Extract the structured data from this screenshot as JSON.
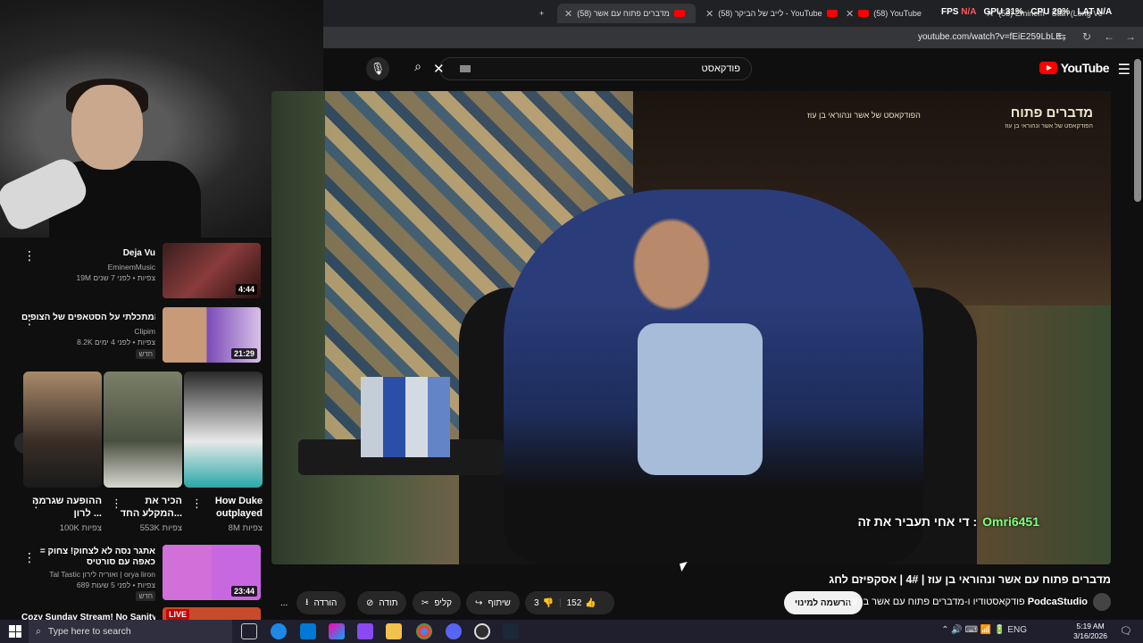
{
  "browser": {
    "tabs": [
      {
        "label": "(58) Eminem - Stan (Long Ve"
      },
      {
        "label": "(58) YouTube"
      },
      {
        "label": "(58) לייב של הביקר - YouTube"
      },
      {
        "label": "(58) מדברים פתוח עם אשר"
      }
    ],
    "new_tab": "+",
    "url": "youtube.com/watch?v=fEiE259LbLE"
  },
  "hud": {
    "fps_label": "FPS",
    "fps": "N/A",
    "gpu": "GPU 31%",
    "cpu": "CPU 29%",
    "lat_label": "LAT",
    "lat": "N/A"
  },
  "header": {
    "search_text": "פודקאסט",
    "logo": "YouTube"
  },
  "video": {
    "banner_title": "מדברים פתוח",
    "banner_sub": "הפודקאסט של אשר ונהוראי בן עוז",
    "banner_top_sub": "הפודקאסט של אשר ונהוראי בן עוז",
    "chat_user": "Omri6451",
    "chat_message": "די אחי תעביר את זה :",
    "title": "מדברים פתוח עם אשר ונהוראי בן עוז | 4# | אסקפיזם לחג"
  },
  "actions": {
    "likes": "152",
    "dislikes": "3",
    "share": "שיתוף",
    "clip": "קליפ",
    "thanks": "תודה",
    "download": "הורדה",
    "more": "...",
    "subscribe": "הרשמה למינוי",
    "channel_name": "PodcaStudio",
    "channel_desc": "- פודקאסטודיו ו-מדברים פתוח עם אשר בן עוז"
  },
  "sidebar": {
    "recs": [
      {
        "title": "Deja Vu",
        "channel": "EminemMusic",
        "meta": "19M צפיות • לפני 7 שנים",
        "duration": "4:44",
        "new": ""
      },
      {
        "title": "המתכלתי על הסטאפים של הצופים...",
        "channel": "Clipim",
        "meta": "8.2K צפיות • לפני 4 ימים",
        "duration": "21:29",
        "new": "חדש"
      },
      {
        "title": "אתגר נסה לא לצחוק! צחוק = כאפה עם סורטיס",
        "channel": "Tal Tastic ואוריה לירון | orya liron",
        "meta": "689 צפיות • לפני 5 שעות",
        "duration": "23:44",
        "new": "חדש"
      },
      {
        "title": "Cozy Sunday Stream! No Sanity,",
        "channel": "",
        "meta": "",
        "duration": "",
        "new": ""
      }
    ],
    "shorts": [
      {
        "title": "How Duke outplayed",
        "views": "8M צפיות"
      },
      {
        "title": "הכיר את המקלע החד...",
        "views": "553K צפיות"
      },
      {
        "title": "ההופעה שגרמה לרון ...",
        "views": "100K צפיות"
      }
    ],
    "live_badge": "LIVE"
  },
  "taskbar": {
    "search_placeholder": "Type here to search",
    "time": "5:19 AM",
    "date": "3/16/2026",
    "lang": "ENG"
  }
}
